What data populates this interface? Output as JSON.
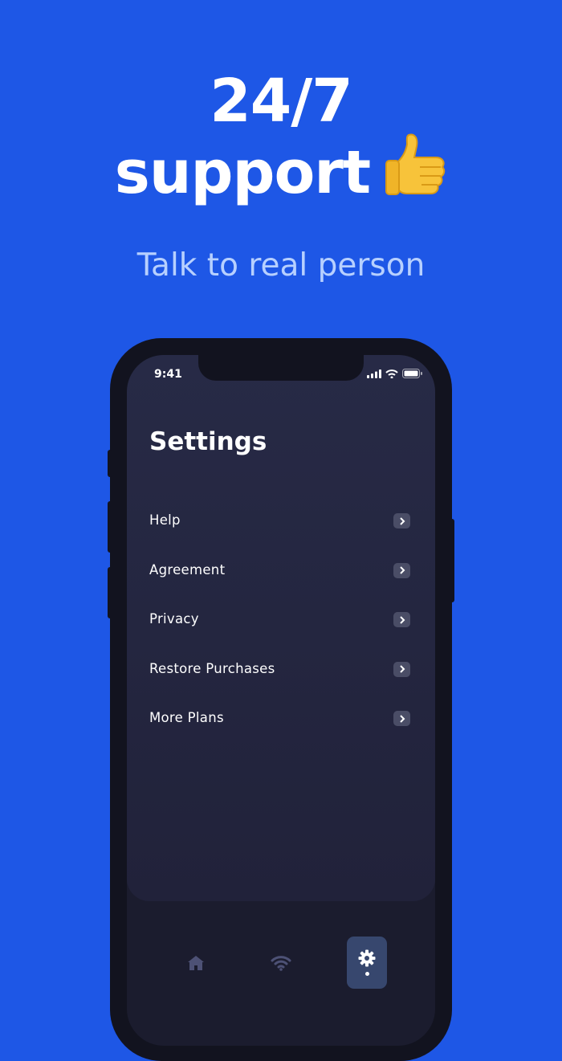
{
  "headline": {
    "line1": "24/7",
    "line2": "support"
  },
  "subtitle": "Talk to real person",
  "status_bar": {
    "time": "9:41"
  },
  "settings": {
    "title": "Settings",
    "items": [
      {
        "label": "Help"
      },
      {
        "label": "Agreement"
      },
      {
        "label": "Privacy"
      },
      {
        "label": "Restore Purchases"
      },
      {
        "label": "More Plans"
      }
    ]
  },
  "tabbar": {
    "tabs": [
      {
        "icon": "home-icon",
        "active": false
      },
      {
        "icon": "wifi-icon",
        "active": false
      },
      {
        "icon": "gear-icon",
        "active": true
      }
    ]
  },
  "colors": {
    "background": "#1e57e6",
    "subtitle": "#b7d0ff",
    "screen": "#272a46",
    "active_tab": "#37476e"
  }
}
